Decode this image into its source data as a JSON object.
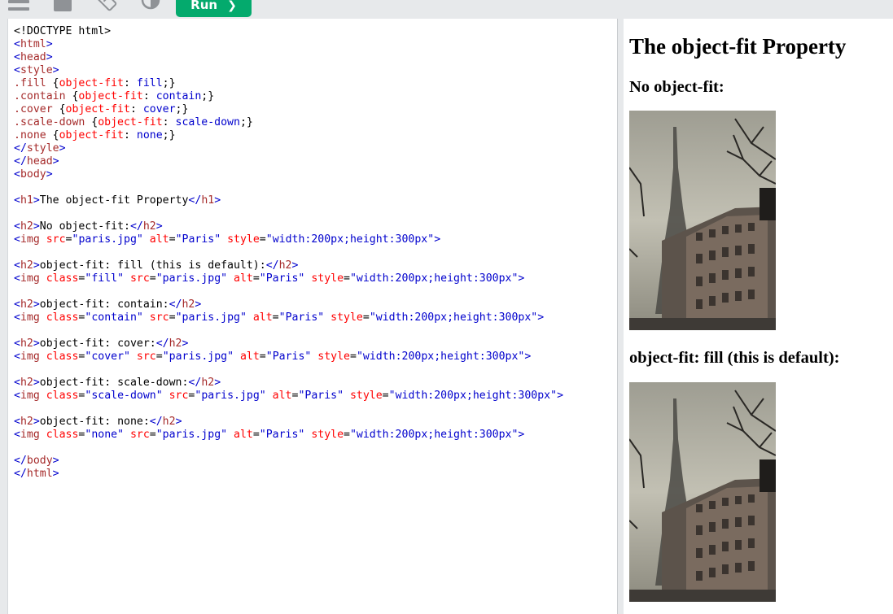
{
  "toolbar": {
    "run_label": "Run",
    "icons": [
      "menu-icon",
      "document-icon",
      "rotate-icon",
      "contrast-icon",
      "chevron-right-icon"
    ]
  },
  "editor": {
    "lines": [
      [
        {
          "t": "txt",
          "s": "<!DOCTYPE html>"
        }
      ],
      [
        {
          "t": "br",
          "s": "<"
        },
        {
          "t": "tag",
          "s": "html"
        },
        {
          "t": "br",
          "s": ">"
        }
      ],
      [
        {
          "t": "br",
          "s": "<"
        },
        {
          "t": "tag",
          "s": "head"
        },
        {
          "t": "br",
          "s": ">"
        }
      ],
      [
        {
          "t": "br",
          "s": "<"
        },
        {
          "t": "tag",
          "s": "style"
        },
        {
          "t": "br",
          "s": ">"
        }
      ],
      [
        {
          "t": "tag",
          "s": ".fill "
        },
        {
          "t": "txt",
          "s": "{"
        },
        {
          "t": "attr",
          "s": "object-fit"
        },
        {
          "t": "txt",
          "s": ": "
        },
        {
          "t": "val",
          "s": "fill"
        },
        {
          "t": "txt",
          "s": ";}"
        }
      ],
      [
        {
          "t": "tag",
          "s": ".contain "
        },
        {
          "t": "txt",
          "s": "{"
        },
        {
          "t": "attr",
          "s": "object-fit"
        },
        {
          "t": "txt",
          "s": ": "
        },
        {
          "t": "val",
          "s": "contain"
        },
        {
          "t": "txt",
          "s": ";}"
        }
      ],
      [
        {
          "t": "tag",
          "s": ".cover "
        },
        {
          "t": "txt",
          "s": "{"
        },
        {
          "t": "attr",
          "s": "object-fit"
        },
        {
          "t": "txt",
          "s": ": "
        },
        {
          "t": "val",
          "s": "cover"
        },
        {
          "t": "txt",
          "s": ";}"
        }
      ],
      [
        {
          "t": "tag",
          "s": ".scale-down "
        },
        {
          "t": "txt",
          "s": "{"
        },
        {
          "t": "attr",
          "s": "object-fit"
        },
        {
          "t": "txt",
          "s": ": "
        },
        {
          "t": "val",
          "s": "scale-down"
        },
        {
          "t": "txt",
          "s": ";}"
        }
      ],
      [
        {
          "t": "tag",
          "s": ".none "
        },
        {
          "t": "txt",
          "s": "{"
        },
        {
          "t": "attr",
          "s": "object-fit"
        },
        {
          "t": "txt",
          "s": ": "
        },
        {
          "t": "val",
          "s": "none"
        },
        {
          "t": "txt",
          "s": ";}"
        }
      ],
      [
        {
          "t": "br",
          "s": "</"
        },
        {
          "t": "tag",
          "s": "style"
        },
        {
          "t": "br",
          "s": ">"
        }
      ],
      [
        {
          "t": "br",
          "s": "</"
        },
        {
          "t": "tag",
          "s": "head"
        },
        {
          "t": "br",
          "s": ">"
        }
      ],
      [
        {
          "t": "br",
          "s": "<"
        },
        {
          "t": "tag",
          "s": "body"
        },
        {
          "t": "br",
          "s": ">"
        }
      ],
      [],
      [
        {
          "t": "br",
          "s": "<"
        },
        {
          "t": "tag",
          "s": "h1"
        },
        {
          "t": "br",
          "s": ">"
        },
        {
          "t": "txt",
          "s": "The object-fit Property"
        },
        {
          "t": "br",
          "s": "</"
        },
        {
          "t": "tag",
          "s": "h1"
        },
        {
          "t": "br",
          "s": ">"
        }
      ],
      [],
      [
        {
          "t": "br",
          "s": "<"
        },
        {
          "t": "tag",
          "s": "h2"
        },
        {
          "t": "br",
          "s": ">"
        },
        {
          "t": "txt",
          "s": "No object-fit:"
        },
        {
          "t": "br",
          "s": "</"
        },
        {
          "t": "tag",
          "s": "h2"
        },
        {
          "t": "br",
          "s": ">"
        }
      ],
      [
        {
          "t": "br",
          "s": "<"
        },
        {
          "t": "tag",
          "s": "img "
        },
        {
          "t": "attr",
          "s": "src"
        },
        {
          "t": "txt",
          "s": "="
        },
        {
          "t": "val",
          "s": "\"paris.jpg\" "
        },
        {
          "t": "attr",
          "s": "alt"
        },
        {
          "t": "txt",
          "s": "="
        },
        {
          "t": "val",
          "s": "\"Paris\" "
        },
        {
          "t": "attr",
          "s": "style"
        },
        {
          "t": "txt",
          "s": "="
        },
        {
          "t": "val",
          "s": "\"width:200px;height:300px\""
        },
        {
          "t": "br",
          "s": ">"
        }
      ],
      [],
      [
        {
          "t": "br",
          "s": "<"
        },
        {
          "t": "tag",
          "s": "h2"
        },
        {
          "t": "br",
          "s": ">"
        },
        {
          "t": "txt",
          "s": "object-fit: fill (this is default):"
        },
        {
          "t": "br",
          "s": "</"
        },
        {
          "t": "tag",
          "s": "h2"
        },
        {
          "t": "br",
          "s": ">"
        }
      ],
      [
        {
          "t": "br",
          "s": "<"
        },
        {
          "t": "tag",
          "s": "img "
        },
        {
          "t": "attr",
          "s": "class"
        },
        {
          "t": "txt",
          "s": "="
        },
        {
          "t": "val",
          "s": "\"fill\" "
        },
        {
          "t": "attr",
          "s": "src"
        },
        {
          "t": "txt",
          "s": "="
        },
        {
          "t": "val",
          "s": "\"paris.jpg\" "
        },
        {
          "t": "attr",
          "s": "alt"
        },
        {
          "t": "txt",
          "s": "="
        },
        {
          "t": "val",
          "s": "\"Paris\" "
        },
        {
          "t": "attr",
          "s": "style"
        },
        {
          "t": "txt",
          "s": "="
        },
        {
          "t": "val",
          "s": "\"width:200px;height:300px\""
        },
        {
          "t": "br",
          "s": ">"
        }
      ],
      [],
      [
        {
          "t": "br",
          "s": "<"
        },
        {
          "t": "tag",
          "s": "h2"
        },
        {
          "t": "br",
          "s": ">"
        },
        {
          "t": "txt",
          "s": "object-fit: contain:"
        },
        {
          "t": "br",
          "s": "</"
        },
        {
          "t": "tag",
          "s": "h2"
        },
        {
          "t": "br",
          "s": ">"
        }
      ],
      [
        {
          "t": "br",
          "s": "<"
        },
        {
          "t": "tag",
          "s": "img "
        },
        {
          "t": "attr",
          "s": "class"
        },
        {
          "t": "txt",
          "s": "="
        },
        {
          "t": "val",
          "s": "\"contain\" "
        },
        {
          "t": "attr",
          "s": "src"
        },
        {
          "t": "txt",
          "s": "="
        },
        {
          "t": "val",
          "s": "\"paris.jpg\" "
        },
        {
          "t": "attr",
          "s": "alt"
        },
        {
          "t": "txt",
          "s": "="
        },
        {
          "t": "val",
          "s": "\"Paris\" "
        },
        {
          "t": "attr",
          "s": "style"
        },
        {
          "t": "txt",
          "s": "="
        },
        {
          "t": "val",
          "s": "\"width:200px;height:300px\""
        },
        {
          "t": "br",
          "s": ">"
        }
      ],
      [],
      [
        {
          "t": "br",
          "s": "<"
        },
        {
          "t": "tag",
          "s": "h2"
        },
        {
          "t": "br",
          "s": ">"
        },
        {
          "t": "txt",
          "s": "object-fit: cover:"
        },
        {
          "t": "br",
          "s": "</"
        },
        {
          "t": "tag",
          "s": "h2"
        },
        {
          "t": "br",
          "s": ">"
        }
      ],
      [
        {
          "t": "br",
          "s": "<"
        },
        {
          "t": "tag",
          "s": "img "
        },
        {
          "t": "attr",
          "s": "class"
        },
        {
          "t": "txt",
          "s": "="
        },
        {
          "t": "val",
          "s": "\"cover\" "
        },
        {
          "t": "attr",
          "s": "src"
        },
        {
          "t": "txt",
          "s": "="
        },
        {
          "t": "val",
          "s": "\"paris.jpg\" "
        },
        {
          "t": "attr",
          "s": "alt"
        },
        {
          "t": "txt",
          "s": "="
        },
        {
          "t": "val",
          "s": "\"Paris\" "
        },
        {
          "t": "attr",
          "s": "style"
        },
        {
          "t": "txt",
          "s": "="
        },
        {
          "t": "val",
          "s": "\"width:200px;height:300px\""
        },
        {
          "t": "br",
          "s": ">"
        }
      ],
      [],
      [
        {
          "t": "br",
          "s": "<"
        },
        {
          "t": "tag",
          "s": "h2"
        },
        {
          "t": "br",
          "s": ">"
        },
        {
          "t": "txt",
          "s": "object-fit: scale-down:"
        },
        {
          "t": "br",
          "s": "</"
        },
        {
          "t": "tag",
          "s": "h2"
        },
        {
          "t": "br",
          "s": ">"
        }
      ],
      [
        {
          "t": "br",
          "s": "<"
        },
        {
          "t": "tag",
          "s": "img "
        },
        {
          "t": "attr",
          "s": "class"
        },
        {
          "t": "txt",
          "s": "="
        },
        {
          "t": "val",
          "s": "\"scale-down\" "
        },
        {
          "t": "attr",
          "s": "src"
        },
        {
          "t": "txt",
          "s": "="
        },
        {
          "t": "val",
          "s": "\"paris.jpg\" "
        },
        {
          "t": "attr",
          "s": "alt"
        },
        {
          "t": "txt",
          "s": "="
        },
        {
          "t": "val",
          "s": "\"Paris\" "
        },
        {
          "t": "attr",
          "s": "style"
        },
        {
          "t": "txt",
          "s": "="
        },
        {
          "t": "val",
          "s": "\"width:200px;height:300px\""
        },
        {
          "t": "br",
          "s": ">"
        }
      ],
      [],
      [
        {
          "t": "br",
          "s": "<"
        },
        {
          "t": "tag",
          "s": "h2"
        },
        {
          "t": "br",
          "s": ">"
        },
        {
          "t": "txt",
          "s": "object-fit: none:"
        },
        {
          "t": "br",
          "s": "</"
        },
        {
          "t": "tag",
          "s": "h2"
        },
        {
          "t": "br",
          "s": ">"
        }
      ],
      [
        {
          "t": "br",
          "s": "<"
        },
        {
          "t": "tag",
          "s": "img "
        },
        {
          "t": "attr",
          "s": "class"
        },
        {
          "t": "txt",
          "s": "="
        },
        {
          "t": "val",
          "s": "\"none\" "
        },
        {
          "t": "attr",
          "s": "src"
        },
        {
          "t": "txt",
          "s": "="
        },
        {
          "t": "val",
          "s": "\"paris.jpg\" "
        },
        {
          "t": "attr",
          "s": "alt"
        },
        {
          "t": "txt",
          "s": "="
        },
        {
          "t": "val",
          "s": "\"Paris\" "
        },
        {
          "t": "attr",
          "s": "style"
        },
        {
          "t": "txt",
          "s": "="
        },
        {
          "t": "val",
          "s": "\"width:200px;height:300px\""
        },
        {
          "t": "br",
          "s": ">"
        }
      ],
      [],
      [
        {
          "t": "br",
          "s": "</"
        },
        {
          "t": "tag",
          "s": "body"
        },
        {
          "t": "br",
          "s": ">"
        }
      ],
      [
        {
          "t": "br",
          "s": "</"
        },
        {
          "t": "tag",
          "s": "html"
        },
        {
          "t": "br",
          "s": ">"
        }
      ]
    ]
  },
  "result": {
    "h1": "The object-fit Property",
    "h2_no_fit": "No object-fit:",
    "h2_fill": "object-fit: fill (this is default):"
  },
  "colors": {
    "run_button": "#04aa6d",
    "tag": "#a52a2a",
    "attribute": "#ff0000",
    "value": "#0000cd",
    "toolbar_bg": "#e7e9eb"
  }
}
